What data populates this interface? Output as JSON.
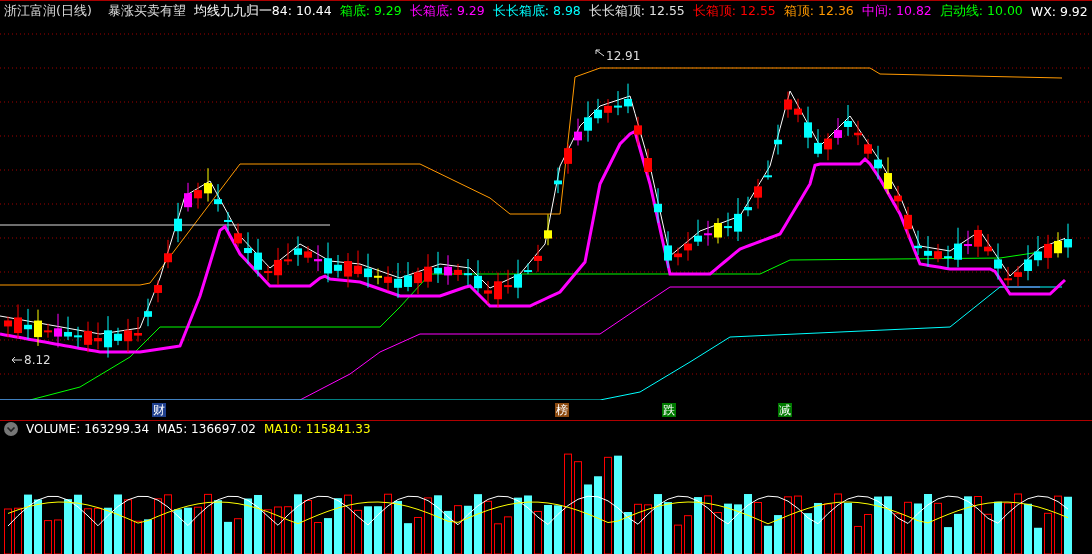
{
  "title": "浙江富润(日线)",
  "indicator_name": "暴涨买卖有望",
  "readouts": [
    {
      "label": "均线九九归一84:",
      "value": "10.44",
      "color": "#ffffff"
    },
    {
      "label": "箱底:",
      "value": "9.29",
      "color": "#00ff00"
    },
    {
      "label": "长箱底:",
      "value": "9.29",
      "color": "#ff00ff"
    },
    {
      "label": "长长箱底:",
      "value": "8.98",
      "color": "#00ffff"
    },
    {
      "label": "长长箱顶:",
      "value": "12.55",
      "color": "#e0e0e0"
    },
    {
      "label": "长箱顶:",
      "value": "12.55",
      "color": "#ff0000"
    },
    {
      "label": "箱顶:",
      "value": "12.36",
      "color": "#ff9900"
    },
    {
      "label": "中间:",
      "value": "10.82",
      "color": "#ff00ff"
    },
    {
      "label": "启动线:",
      "value": "10.00",
      "color": "#00ff00"
    },
    {
      "label": "WX:",
      "value": "9.92",
      "color": "#ffffff"
    }
  ],
  "price_labels": [
    "12.91",
    "8.12"
  ],
  "signals": [
    {
      "text": "财",
      "color": "#1f3f8c"
    },
    {
      "text": "榜",
      "color": "#8b4a10"
    },
    {
      "text": "跌",
      "color": "#007a00"
    },
    {
      "text": "减",
      "color": "#007a00"
    }
  ],
  "volume_readouts": [
    {
      "label": "VOLUME:",
      "value": "163299.34",
      "color": "#ffffff"
    },
    {
      "label": "MA5:",
      "value": "136697.02",
      "color": "#ffffff"
    },
    {
      "label": "MA10:",
      "value": "115841.33",
      "color": "#ffff00"
    }
  ]
}
